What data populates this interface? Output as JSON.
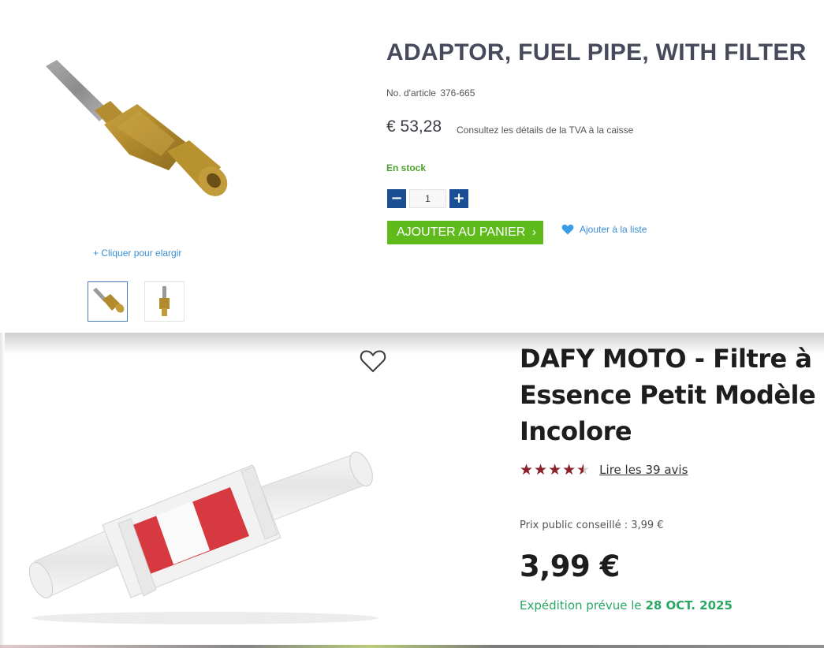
{
  "product1": {
    "title": "ADAPTOR, FUEL PIPE, WITH FILTER",
    "article_label": "No. d'article",
    "article_number": "376-665",
    "price": "€ 53,28",
    "vat_note": "Consultez les détails de la TVA à la caisse",
    "stock": "En stock",
    "quantity": "1",
    "minus_label": "−",
    "plus_label": "+",
    "add_to_cart": "AJOUTER AU PANIER",
    "add_to_cart_chevron": "›",
    "wishlist": "Ajouter à la liste",
    "zoom_link": "+ Cliquer pour elargir",
    "colors": {
      "title": "#464a5a",
      "qty_button": "#1a4f96",
      "cart_button": "#5fba1c",
      "stock": "#4aa02c",
      "link": "#3a8fd6"
    }
  },
  "product2": {
    "title": "DAFY MOTO - Filtre à Essence Petit Modèle Incolore",
    "rating": 4.5,
    "stars_glyphs": "★★★★★",
    "reviews_link": "Lire les 39 avis",
    "rrp": "Prix public conseillé : 3,99 €",
    "price": "3,99 €",
    "shipping_prefix": "Expédition prévue le",
    "shipping_date": "28 OCT. 2025",
    "colors": {
      "stars": "#8c2129",
      "shipping": "#2aa765",
      "title": "#1d1d1d"
    }
  }
}
